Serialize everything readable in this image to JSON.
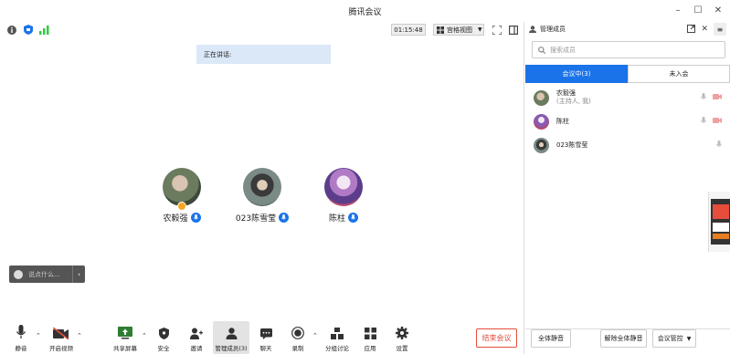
{
  "window": {
    "title": "腾讯会议"
  },
  "status": {
    "timer": "01:15:48",
    "view_label": "宫格视图"
  },
  "speaking": {
    "label": "正在讲话:"
  },
  "participants": [
    {
      "name": "农毅强"
    },
    {
      "name": "023陈雪莹"
    },
    {
      "name": "陈柱"
    }
  ],
  "chat": {
    "placeholder": "说点什么..."
  },
  "toolbar": {
    "mute": "静音",
    "video": "开启视频",
    "share": "共享屏幕",
    "security": "安全",
    "invite": "邀请",
    "members": "管理成员(3)",
    "chat": "聊天",
    "record": "录制",
    "breakout": "分组讨论",
    "apps": "应用",
    "settings": "设置",
    "end": "结束会议"
  },
  "panel": {
    "title": "管理成员",
    "search_placeholder": "搜索成员",
    "tab_in": "会议中(3)",
    "tab_out": "未入会",
    "members": [
      {
        "name": "农毅强",
        "sub": "(主持人, 我)"
      },
      {
        "name": "陈柱",
        "sub": ""
      },
      {
        "name": "023陈雪莹",
        "sub": ""
      }
    ],
    "mute_all": "全体静音",
    "unmute_all": "解除全体静音",
    "control": "会议管控"
  },
  "colors": {
    "accent": "#1a73e8",
    "end": "#e74c3c"
  }
}
